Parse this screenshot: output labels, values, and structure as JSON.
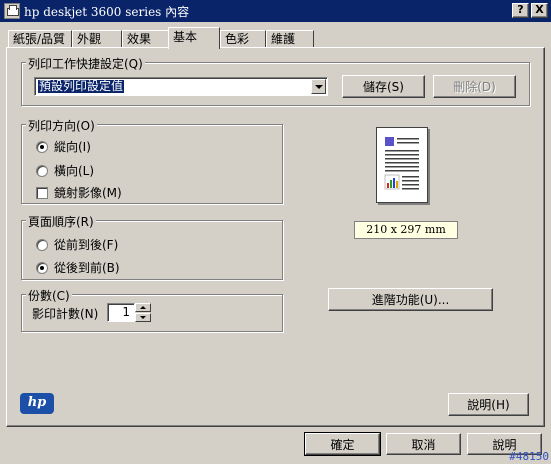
{
  "window": {
    "title": "hp deskjet 3600 series 內容",
    "help_button": "?",
    "close_button": "X"
  },
  "tabs": [
    {
      "label": "紙張/品質"
    },
    {
      "label": "外觀"
    },
    {
      "label": "效果"
    },
    {
      "label": "基本",
      "active": true
    },
    {
      "label": "色彩"
    },
    {
      "label": "維護"
    }
  ],
  "quick_sets": {
    "group_label": "列印工作快捷設定(Q)",
    "selected_value": "預設列印設定值",
    "save_label": "儲存(S)",
    "delete_label": "刪除(D)",
    "delete_enabled": false
  },
  "orientation": {
    "group_label": "列印方向(O)",
    "options": [
      {
        "label": "縱向(I)",
        "checked": true
      },
      {
        "label": "橫向(L)",
        "checked": false
      }
    ],
    "mirror_label": "鏡射影像(M)",
    "mirror_checked": false
  },
  "page_order": {
    "group_label": "頁面順序(R)",
    "options": [
      {
        "label": "從前到後(F)",
        "checked": false
      },
      {
        "label": "從後到前(B)",
        "checked": true
      }
    ]
  },
  "copies": {
    "group_label": "份數(C)",
    "field_label": "影印計數(N)",
    "value": "1"
  },
  "preview": {
    "paper_size": "210 x 297 mm"
  },
  "advanced_button": "進階功能(U)...",
  "logo_text": "hp",
  "help_label": "說明(H)",
  "footer": {
    "ok": "確定",
    "cancel": "取消",
    "help": "說明"
  },
  "watermark": "#48150",
  "colors": {
    "title_bar": "#0a246a",
    "dialog_bg": "#d4d0c8",
    "paper_label_bg": "#ffffe1",
    "hp_logo": "#1c4fa8"
  }
}
